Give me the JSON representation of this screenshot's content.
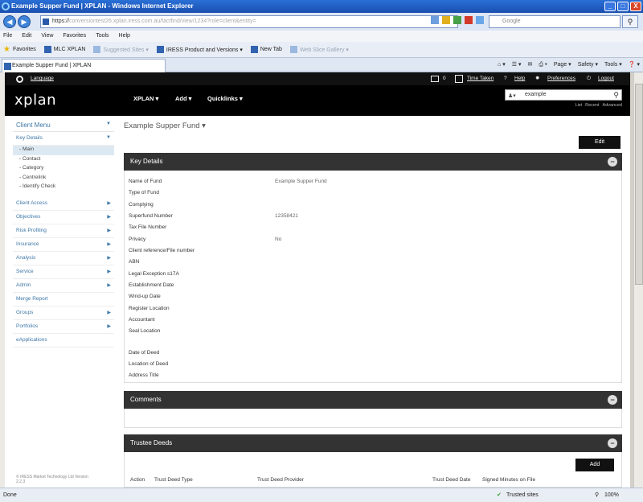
{
  "window": {
    "title": "Example Supper Fund | XPLAN - Windows Internet Explorer",
    "minimize": "_",
    "restore": "□",
    "close": "X"
  },
  "address_bar": {
    "url": "https://",
    "url_dim": "conversiontest26.xplan.iress.com.au/factfind/view/1234?role=client&entity=",
    "search_placeholder": "Google",
    "back": "◀",
    "forward": "▶",
    "search_go": "⚲"
  },
  "menu": [
    "File",
    "Edit",
    "View",
    "Favorites",
    "Tools",
    "Help"
  ],
  "favorites": {
    "label": "Favorites",
    "items": [
      {
        "label": "MLC XPLAN",
        "faded": false
      },
      {
        "label": "Suggested Sites ▾",
        "faded": true
      },
      {
        "label": "IRESS Product and Versions ▾",
        "faded": false
      },
      {
        "label": "New Tab",
        "faded": false
      },
      {
        "label": "Web Slice Gallery ▾",
        "faded": true
      }
    ]
  },
  "tab": {
    "label": "Example Supper Fund | XPLAN"
  },
  "command_bar": [
    "Page ▾",
    "Safety ▾",
    "Tools ▾",
    "❓ ▾"
  ],
  "xplan": {
    "top": {
      "language": "Language",
      "msg_count": "0",
      "time_taken": "Time Taken",
      "help": "Help",
      "preferences": "Preferences",
      "logout": "Logout"
    },
    "logo": "xplan",
    "menus": [
      "XPLAN ▾",
      "Add ▾",
      "Quicklinks ▾"
    ],
    "search_value": "example",
    "search_links": [
      "List",
      "Recent",
      "Advanced"
    ]
  },
  "sidebar": {
    "client_menu": "Client Menu",
    "key_details": "Key Details",
    "sub_items": [
      "Main",
      "Contact",
      "Category",
      "Centrelink",
      "Identify Check"
    ],
    "sections": [
      {
        "label": "Client Access",
        "arrow": true
      },
      {
        "label": "Objectives",
        "arrow": true
      },
      {
        "label": "Risk Profiling",
        "arrow": true
      },
      {
        "label": "Insurance",
        "arrow": true
      },
      {
        "label": "Analysis",
        "arrow": true
      },
      {
        "label": "Service",
        "arrow": true
      },
      {
        "label": "Admin",
        "arrow": true
      },
      {
        "label": "Merge Report",
        "arrow": false
      },
      {
        "label": "Groups",
        "arrow": true
      },
      {
        "label": "Portfolios",
        "arrow": true
      },
      {
        "label": "eApplications",
        "arrow": false
      }
    ],
    "copyright": "© IRESS Market Technology Ltd Version 2.2.3"
  },
  "main": {
    "title": "Example Supper Fund ▾",
    "edit_label": "Edit",
    "key_details_header": "Key Details",
    "fields": [
      {
        "label": "Name of Fund",
        "value": "Example Supper Fund"
      },
      {
        "label": "Type of Fund",
        "value": ""
      },
      {
        "label": "Complying",
        "value": ""
      },
      {
        "label": "Superfund Number",
        "value": "12358421"
      },
      {
        "label": "Tax File Number",
        "value": ""
      },
      {
        "label": "Privacy",
        "value": "No"
      },
      {
        "label": "Client reference/File number",
        "value": ""
      },
      {
        "label": "ABN",
        "value": ""
      },
      {
        "label": "Legal Exception s17A",
        "value": ""
      },
      {
        "label": "Establishment Date",
        "value": ""
      },
      {
        "label": "Wind-up Date",
        "value": ""
      },
      {
        "label": "Register Location",
        "value": ""
      },
      {
        "label": "Accountant",
        "value": ""
      },
      {
        "label": "Seal Location",
        "value": ""
      }
    ],
    "deed_fields": [
      {
        "label": "Date of Deed",
        "value": ""
      },
      {
        "label": "Location of Deed",
        "value": ""
      },
      {
        "label": "Address Title",
        "value": ""
      }
    ],
    "comments_header": "Comments",
    "trustee_header": "Trustee Deeds",
    "add_label": "Add",
    "columns": [
      "Action",
      "Trust Deed Type",
      "Trust Deed Provider",
      "Trust Deed Date",
      "Signed Minutes on File"
    ]
  },
  "statusbar": {
    "left": "Done",
    "trusted": "Trusted sites",
    "zoom": "100%"
  }
}
